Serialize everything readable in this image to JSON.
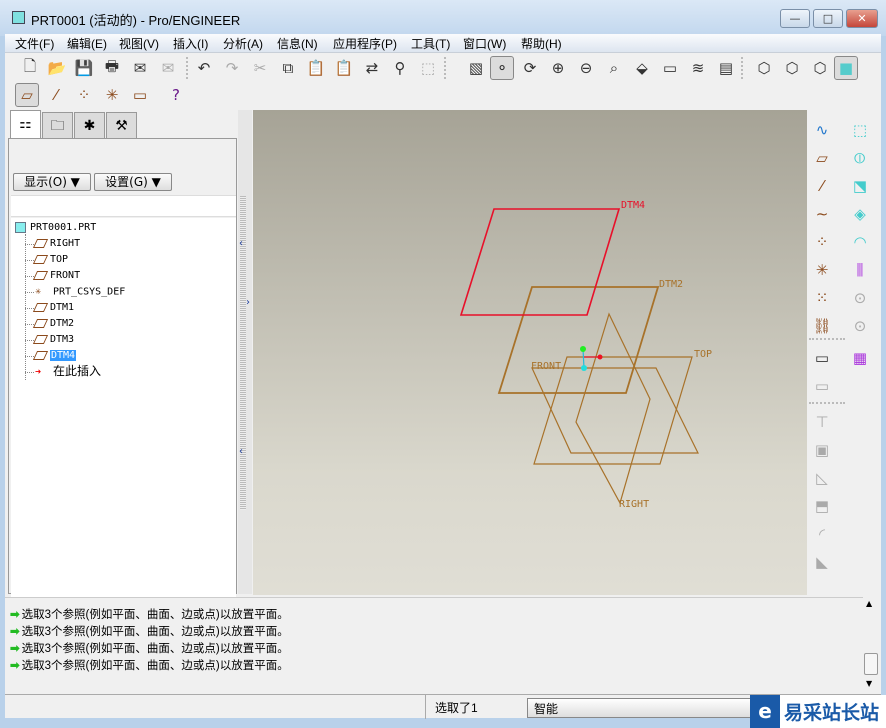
{
  "window": {
    "title": "PRT0001 (活动的) - Pro/ENGINEER",
    "controls": {
      "minimize": "—",
      "maximize": "□",
      "close": "✕"
    }
  },
  "menu": [
    "文件(F)",
    "编辑(E)",
    "视图(V)",
    "插入(I)",
    "分析(A)",
    "信息(N)",
    "应用程序(P)",
    "工具(T)",
    "窗口(W)",
    "帮助(H)"
  ],
  "toolbar1": [
    {
      "icon": "new-file-icon",
      "g": "🗋"
    },
    {
      "icon": "open-folder-icon",
      "g": "📂"
    },
    {
      "icon": "save-icon",
      "g": "💾"
    },
    {
      "icon": "print-icon",
      "g": "🖶"
    },
    {
      "icon": "email-icon",
      "g": "✉"
    },
    {
      "icon": "email-link-icon",
      "g": "✉",
      "disabled": true
    },
    {
      "icon": "undo-icon",
      "g": "↶"
    },
    {
      "icon": "redo-icon",
      "g": "↷",
      "disabled": true
    },
    {
      "icon": "cut-icon",
      "g": "✂",
      "disabled": true
    },
    {
      "icon": "copy-icon",
      "g": "⧉"
    },
    {
      "icon": "paste-icon",
      "g": "📋",
      "disabled": true
    },
    {
      "icon": "paste-special-icon",
      "g": "📋",
      "disabled": true
    },
    {
      "icon": "regenerate-icon",
      "g": "⇄"
    },
    {
      "icon": "find-icon",
      "g": "⚲"
    },
    {
      "icon": "select-box-icon",
      "g": "⬚",
      "disabled": true
    },
    {
      "icon": "repaint-icon",
      "g": "▧"
    },
    {
      "icon": "spin-center-icon",
      "g": "⚬"
    },
    {
      "icon": "orient-mode-icon",
      "g": "⟳"
    },
    {
      "icon": "zoom-in-icon",
      "g": "⊕"
    },
    {
      "icon": "zoom-out-icon",
      "g": "⊖"
    },
    {
      "icon": "refit-icon",
      "g": "⌕"
    },
    {
      "icon": "reorient-icon",
      "g": "⬙"
    },
    {
      "icon": "saved-views-icon",
      "g": "▭"
    },
    {
      "icon": "layers-icon",
      "g": "≋"
    },
    {
      "icon": "view-manager-icon",
      "g": "▤"
    },
    {
      "icon": "wireframe-icon",
      "g": "⬡"
    },
    {
      "icon": "hidden-line-icon",
      "g": "⬡"
    },
    {
      "icon": "no-hidden-icon",
      "g": "⬡"
    },
    {
      "icon": "shading-icon",
      "g": "■"
    }
  ],
  "toolbar2": [
    {
      "icon": "datum-plane-display-icon",
      "g": "▱"
    },
    {
      "icon": "datum-axis-display-icon",
      "g": "⁄"
    },
    {
      "icon": "datum-point-display-icon",
      "g": "⁘"
    },
    {
      "icon": "csys-display-icon",
      "g": "✳"
    },
    {
      "icon": "annotation-display-icon",
      "g": "▭"
    },
    {
      "icon": "context-help-icon",
      "g": "?"
    }
  ],
  "panel": {
    "tabs": [
      "model-tree-tab",
      "folder-browser-tab",
      "favorites-tab",
      "connections-tab"
    ],
    "show_btn": "显示(O) ▼",
    "settings_btn": "设置(G) ▼"
  },
  "tree": [
    {
      "label": "PRT0001.PRT",
      "icon": "part-icon"
    },
    {
      "label": "RIGHT",
      "icon": "datum-plane-icon"
    },
    {
      "label": "TOP",
      "icon": "datum-plane-icon"
    },
    {
      "label": "FRONT",
      "icon": "datum-plane-icon"
    },
    {
      "label": "PRT_CSYS_DEF",
      "icon": "csys-icon"
    },
    {
      "label": "DTM1",
      "icon": "datum-plane-icon"
    },
    {
      "label": "DTM2",
      "icon": "datum-plane-icon"
    },
    {
      "label": "DTM3",
      "icon": "datum-plane-icon"
    },
    {
      "label": "DTM4",
      "icon": "datum-plane-icon",
      "selected": true
    },
    {
      "label": "在此插入",
      "icon": "insert-here-arrow-icon"
    }
  ],
  "viewport": {
    "labels": {
      "dtm4": "DTM4",
      "dtm2": "DTM2",
      "top": "TOP",
      "front": "FRONT",
      "right": "RIGHT"
    },
    "colors": {
      "datum": "#a8722a",
      "selected": "#e8102a"
    }
  },
  "rightbar": [
    [
      "sketch-tool-icon",
      "∿"
    ],
    [
      "extrude-icon",
      "⬚"
    ],
    [
      "plane-tool-icon",
      "▱"
    ],
    [
      "revolve-icon",
      "⦶"
    ],
    [
      "axis-tool-icon",
      "⁄"
    ],
    [
      "sweep-icon",
      "⬔"
    ],
    [
      "curve-tool-icon",
      "∼"
    ],
    [
      "blend-icon",
      "◈"
    ],
    [
      "point-tool-icon",
      "⁘"
    ],
    [
      "boundary-blend-icon",
      "◠"
    ],
    [
      "csys-tool-icon",
      "✳"
    ],
    [
      "mirror-icon",
      "⫼"
    ],
    [
      "analysis-feature-icon",
      "⁙"
    ],
    [
      "merge-icon",
      "⊙"
    ],
    [
      "chain-icon",
      "⛓"
    ],
    [
      "trim-icon",
      "⊙"
    ],
    [
      "annotation-feature-icon",
      "▭"
    ],
    [
      "pattern-icon",
      "▦"
    ],
    [
      "copy-annotation-icon",
      "▭"
    ],
    [
      "hole-icon",
      "⊤"
    ],
    [
      "shell-icon",
      "▣"
    ],
    [
      "rib-icon",
      "◺"
    ],
    [
      "draft-icon",
      "⬒"
    ],
    [
      "round-icon",
      "◜"
    ],
    [
      "chamfer-icon",
      "◣"
    ]
  ],
  "messages": [
    "选取3个参照(例如平面、曲面、边或点)以放置平面。",
    "选取3个参照(例如平面、曲面、边或点)以放置平面。",
    "选取3个参照(例如平面、曲面、边或点)以放置平面。",
    "选取3个参照(例如平面、曲面、边或点)以放置平面。"
  ],
  "status": {
    "selected": "选取了1",
    "filter": "智能"
  },
  "watermark": {
    "logo": "e",
    "text": "易采站长站"
  }
}
